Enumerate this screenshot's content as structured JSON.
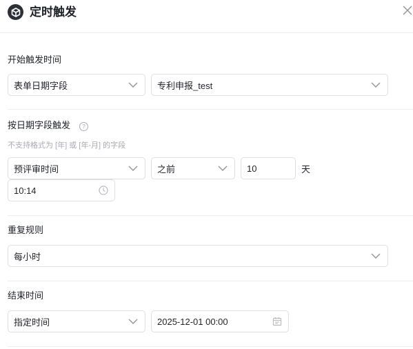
{
  "dialog": {
    "title": "定时触发",
    "logo_icon": "cube-icon",
    "close_icon": "close-icon"
  },
  "start": {
    "label": "开始触发时间",
    "type_select": "表单日期字段",
    "field_select": "专利申报_test"
  },
  "by_field": {
    "label": "按日期字段触发",
    "help_icon": "question-circle-icon",
    "hint": "不支持格式为 [年] 或 [年-月] 的字段",
    "field_select": "预评审时间",
    "direction_select": "之前",
    "offset_value": "10",
    "offset_unit": "天",
    "time_value": "10:14"
  },
  "repeat": {
    "label": "重复规则",
    "select": "每小时"
  },
  "end": {
    "label": "结束时间",
    "type_select": "指定时间",
    "datetime_value": "2025-12-01 00:00",
    "calendar_icon": "calendar-icon"
  },
  "colors": {
    "border": "#dcdfe6",
    "text": "#1f2329",
    "hint": "#a8abb2",
    "divider": "#ebedf0"
  }
}
